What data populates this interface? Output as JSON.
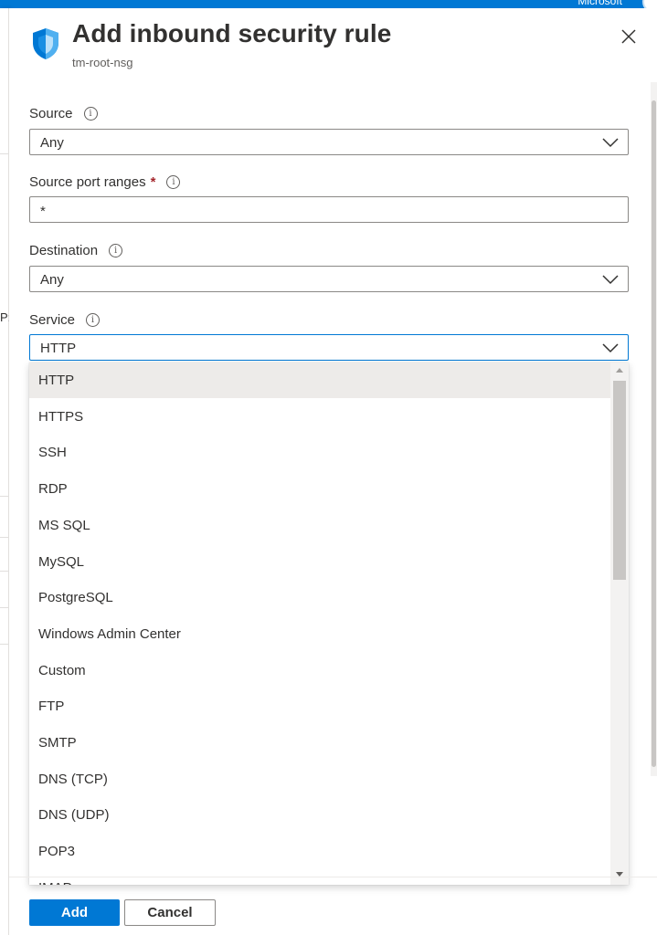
{
  "topbar": {
    "account_text": "Microsoft"
  },
  "blade": {
    "title": "Add inbound security rule",
    "subtitle": "tm-root-nsg"
  },
  "form": {
    "source": {
      "label": "Source",
      "value": "Any"
    },
    "source_port": {
      "label": "Source port ranges",
      "required_mark": "*",
      "value": "*"
    },
    "destination": {
      "label": "Destination",
      "value": "Any"
    },
    "service": {
      "label": "Service",
      "value": "HTTP"
    }
  },
  "service_options": [
    "HTTP",
    "HTTPS",
    "SSH",
    "RDP",
    "MS SQL",
    "MySQL",
    "PostgreSQL",
    "Windows Admin Center",
    "Custom",
    "FTP",
    "SMTP",
    "DNS (TCP)",
    "DNS (UDP)",
    "POP3",
    "IMAP"
  ],
  "background_fragments": {
    "colon": "P:"
  },
  "buttons": {
    "add": "Add",
    "cancel": "Cancel"
  },
  "colors": {
    "accent": "#0078d4",
    "required": "#a4262c"
  },
  "icons": {
    "header": "shield-icon",
    "close": "close-icon",
    "info": "info-icon",
    "chevron": "chevron-down-icon"
  }
}
